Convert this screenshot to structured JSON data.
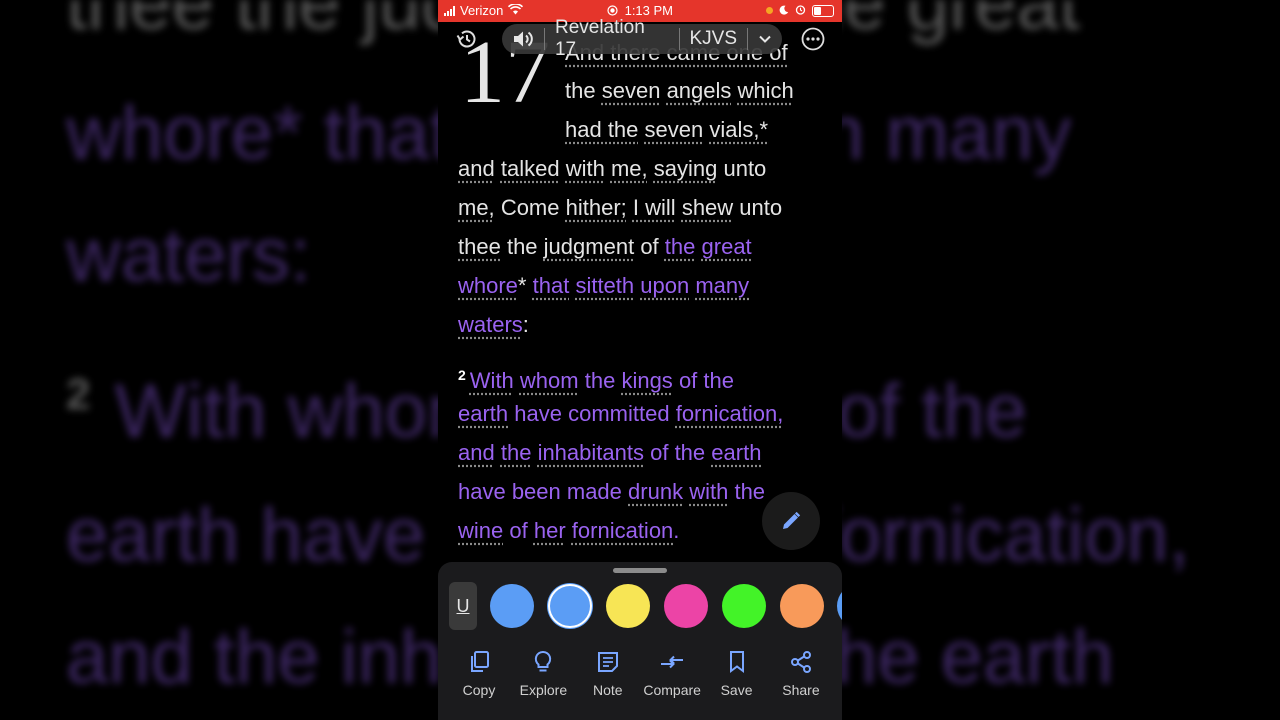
{
  "status": {
    "carrier": "Verizon",
    "time": "1:13 PM"
  },
  "toolbar": {
    "reference": "Revelation 17",
    "version": "KJVS"
  },
  "chapter": {
    "number": "17",
    "verse2_number": "2"
  },
  "verse1": {
    "l1": "And there came one of",
    "l2a": "the",
    "l2b": "seven",
    "l2c": "angels",
    "l2d": "which",
    "l3a": "had the",
    "l3b": "seven",
    "l3c": "vials,*",
    "l4a": "and",
    "l4b": "talked",
    "l4c": "with",
    "l4d": "me,",
    "l4e": "saying",
    "l4f": "unto",
    "l5a": "me,",
    "l5b": "Come",
    "l5c": "hither;",
    "l5d": "I will",
    "l5e": "shew",
    "l5f": "unto",
    "l6a": "thee",
    "l6b": "the",
    "l6c": "judgment",
    "l6d": "of",
    "l6e": "the",
    "l6f": "great",
    "l7a": "whore",
    "l7b": "*",
    "l7c": "that",
    "l7d": "sitteth",
    "l7e": "upon",
    "l7f": "many",
    "l8a": "waters",
    "l8b": ":"
  },
  "verse2": {
    "l1a": "With",
    "l1b": "whom",
    "l1c": "the",
    "l1d": "kings",
    "l1e": "of the",
    "l2a": "earth",
    "l2b": "have committed",
    "l2c": "fornication,",
    "l3a": "and",
    "l3b": "the",
    "l3c": "inhabitants",
    "l3d": "of the",
    "l3e": "earth",
    "l4a": "have been made",
    "l4b": "drunk",
    "l4c": "with",
    "l4d": "the",
    "l5a": "wine",
    "l5b": "of",
    "l5c": "her",
    "l5d": "fornication",
    "l5e": "."
  },
  "background": {
    "l1": "thee the judgment of the great",
    "l2": "whore* that sitteth upon many",
    "l3": "waters:",
    "l4num": "2",
    "l4": "With whom the kings of the",
    "l5": "earth have committed fornication,",
    "l6": "and the inhabitants of the earth"
  },
  "highlight_panel": {
    "underline_label": "U",
    "colors": [
      "#5b9df5",
      "#5b9df5",
      "#f7e555",
      "#ec44a6",
      "#43f328",
      "#f89a5a",
      "#5b9df5"
    ],
    "actions": [
      {
        "label": "Copy",
        "icon": "copy-icon"
      },
      {
        "label": "Explore",
        "icon": "lightbulb-icon"
      },
      {
        "label": "Note",
        "icon": "note-icon"
      },
      {
        "label": "Compare",
        "icon": "compare-icon"
      },
      {
        "label": "Save",
        "icon": "bookmark-icon"
      },
      {
        "label": "Share",
        "icon": "share-icon"
      }
    ]
  },
  "theme": {
    "highlight_purple": "#9a63f0",
    "status_red": "#e5352b"
  }
}
